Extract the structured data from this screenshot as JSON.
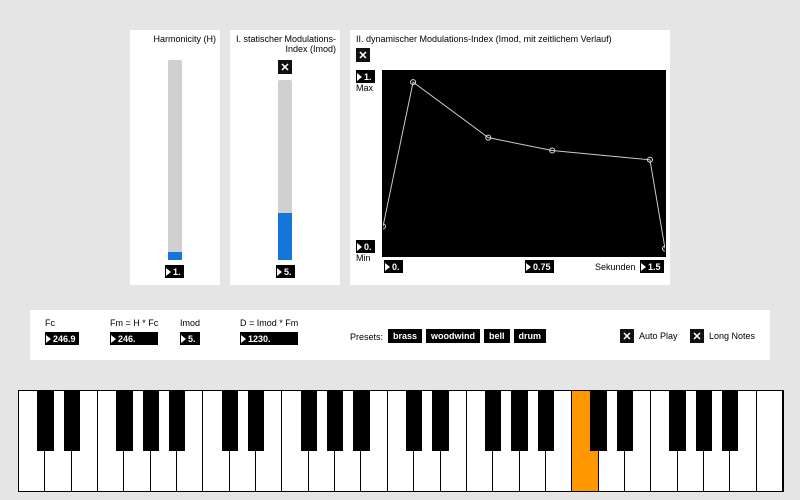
{
  "harmonicity": {
    "label": "Harmonicity (H)",
    "value": "1.",
    "slider_fill_pct": 4
  },
  "static_index": {
    "label": "I. statischer Modulations-Index (Imod)",
    "toggle_glyph": "✕",
    "value": "5.",
    "slider_fill_pct": 26
  },
  "dynamic_index": {
    "label": "II. dynamischer Modulations-Index (Imod, mit zeitlichem Verlauf)",
    "toggle_glyph": "✕",
    "ylabel_max": "Max",
    "ylabel_min": "Min",
    "ymax_value": "1.",
    "ymin_value": "0.",
    "x0_value": "0.",
    "xmid_value": "0.75",
    "xmax_value": "1.5",
    "xunits": "Sekunden",
    "chart_data": {
      "type": "line",
      "x": [
        0.0,
        0.16,
        0.56,
        0.9,
        1.42,
        1.5
      ],
      "y": [
        0.16,
        0.94,
        0.64,
        0.57,
        0.52,
        0.04
      ],
      "xlim": [
        0,
        1.5
      ],
      "ylim": [
        0,
        1
      ]
    }
  },
  "params": {
    "fc": {
      "label": "Fc",
      "value": "246.9"
    },
    "fm": {
      "label": "Fm = H * Fc",
      "value": "246."
    },
    "imod": {
      "label": "Imod",
      "value": "5."
    },
    "d": {
      "label": "D = Imod * Fm",
      "value": "1230."
    }
  },
  "presets": {
    "label": "Presets:",
    "items": [
      "brass",
      "woodwind",
      "bell",
      "drum"
    ]
  },
  "options": {
    "autoplay": {
      "label": "Auto Play",
      "glyph": "✕"
    },
    "longnotes": {
      "label": "Long Notes",
      "glyph": "✕"
    }
  },
  "keyboard": {
    "white_keys": 29,
    "active_white_index": 21,
    "black_pattern": [
      1,
      1,
      0,
      1,
      1,
      1,
      0
    ]
  }
}
